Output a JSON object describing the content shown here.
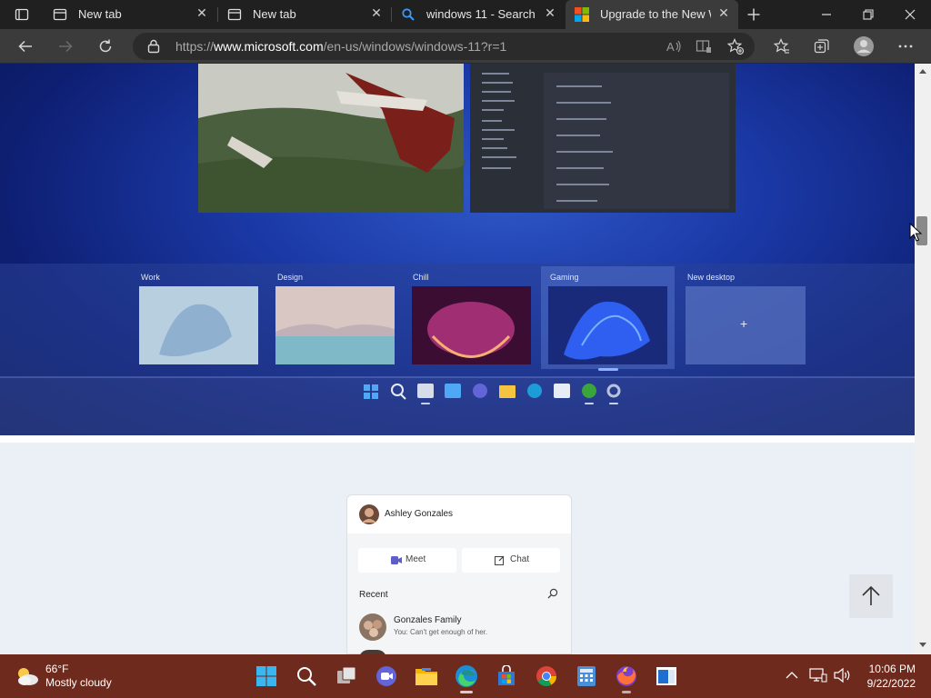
{
  "tabs": [
    {
      "title": "New tab",
      "icon": "new-tab-page-icon"
    },
    {
      "title": "New tab",
      "icon": "new-tab-page-icon"
    },
    {
      "title": "windows 11 - Search",
      "icon": "search-icon"
    },
    {
      "title": "Upgrade to the New W",
      "icon": "microsoft-logo-icon",
      "active": true
    }
  ],
  "address": {
    "prefix": "https://",
    "host": "www.microsoft.com",
    "path": "/en-us/windows/windows-11?r=1"
  },
  "hero": {
    "desktops": [
      {
        "label": "Work"
      },
      {
        "label": "Design"
      },
      {
        "label": "Chill"
      },
      {
        "label": "Gaming"
      },
      {
        "label": "New desktop"
      }
    ],
    "new_desktop_symbol": "+"
  },
  "chat_panel": {
    "user_name": "Ashley Gonzales",
    "meet_label": "Meet",
    "chat_label": "Chat",
    "recent_label": "Recent",
    "contacts": [
      {
        "name": "Gonzales Family",
        "preview": "You: Can't get enough of her."
      }
    ]
  },
  "weather": {
    "temp": "66°F",
    "condition": "Mostly cloudy"
  },
  "clock": {
    "time": "10:06 PM",
    "date": "9/22/2022"
  },
  "colors": {
    "taskbar": "#6e2a1c",
    "chrome_dark": "#202020",
    "toolbar": "#3b3b3b",
    "hero_blue": "#1b3aa8"
  }
}
